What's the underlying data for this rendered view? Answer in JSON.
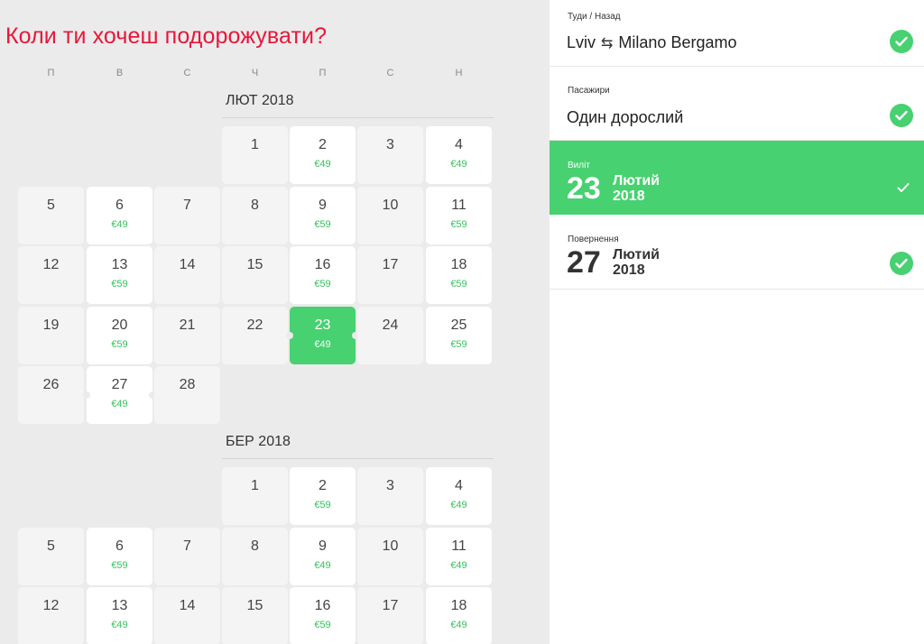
{
  "title": "Коли ти хочеш подорожувати?",
  "weekdays": [
    "П",
    "В",
    "С",
    "Ч",
    "П",
    "С",
    "Н"
  ],
  "months": [
    {
      "label": "ЛЮТ 2018",
      "days": [
        {
          "n": "1",
          "p": ""
        },
        {
          "n": "2",
          "p": "€49"
        },
        {
          "n": "3",
          "p": ""
        },
        {
          "n": "4",
          "p": "€49"
        },
        {
          "n": "5",
          "p": ""
        },
        {
          "n": "6",
          "p": "€49"
        },
        {
          "n": "7",
          "p": ""
        },
        {
          "n": "8",
          "p": ""
        },
        {
          "n": "9",
          "p": "€59"
        },
        {
          "n": "10",
          "p": ""
        },
        {
          "n": "11",
          "p": "€59"
        },
        {
          "n": "12",
          "p": ""
        },
        {
          "n": "13",
          "p": "€59"
        },
        {
          "n": "14",
          "p": ""
        },
        {
          "n": "15",
          "p": ""
        },
        {
          "n": "16",
          "p": "€59"
        },
        {
          "n": "17",
          "p": ""
        },
        {
          "n": "18",
          "p": "€59"
        },
        {
          "n": "19",
          "p": ""
        },
        {
          "n": "20",
          "p": "€59"
        },
        {
          "n": "21",
          "p": ""
        },
        {
          "n": "22",
          "p": ""
        },
        {
          "n": "23",
          "p": "€49",
          "selected": true
        },
        {
          "n": "24",
          "p": ""
        },
        {
          "n": "25",
          "p": "€59"
        },
        {
          "n": "26",
          "p": ""
        },
        {
          "n": "27",
          "p": "€49"
        },
        {
          "n": "28",
          "p": ""
        }
      ]
    },
    {
      "label": "БЕР 2018",
      "days": [
        {
          "n": "1",
          "p": ""
        },
        {
          "n": "2",
          "p": "€59"
        },
        {
          "n": "3",
          "p": ""
        },
        {
          "n": "4",
          "p": "€49"
        },
        {
          "n": "5",
          "p": ""
        },
        {
          "n": "6",
          "p": "€59"
        },
        {
          "n": "7",
          "p": ""
        },
        {
          "n": "8",
          "p": ""
        },
        {
          "n": "9",
          "p": "€49"
        },
        {
          "n": "10",
          "p": ""
        },
        {
          "n": "11",
          "p": "€49"
        },
        {
          "n": "12",
          "p": ""
        },
        {
          "n": "13",
          "p": "€49"
        },
        {
          "n": "14",
          "p": ""
        },
        {
          "n": "15",
          "p": ""
        },
        {
          "n": "16",
          "p": "€59"
        },
        {
          "n": "17",
          "p": ""
        },
        {
          "n": "18",
          "p": "€49"
        }
      ]
    }
  ],
  "summary": {
    "route": {
      "label": "Туди / Назад",
      "from": "Lviv",
      "to": "Milano Bergamo",
      "swap_icon": "⇆"
    },
    "passengers": {
      "label": "Пасажири",
      "value": "Один дорослий"
    },
    "departure": {
      "label": "Виліт",
      "day": "23",
      "month": "Лютий",
      "year": "2018"
    },
    "return": {
      "label": "Повернення",
      "day": "27",
      "month": "Лютий",
      "year": "2018"
    }
  },
  "colors": {
    "accent": "#47d170",
    "title": "#e8173a",
    "price": "#34c25c"
  }
}
